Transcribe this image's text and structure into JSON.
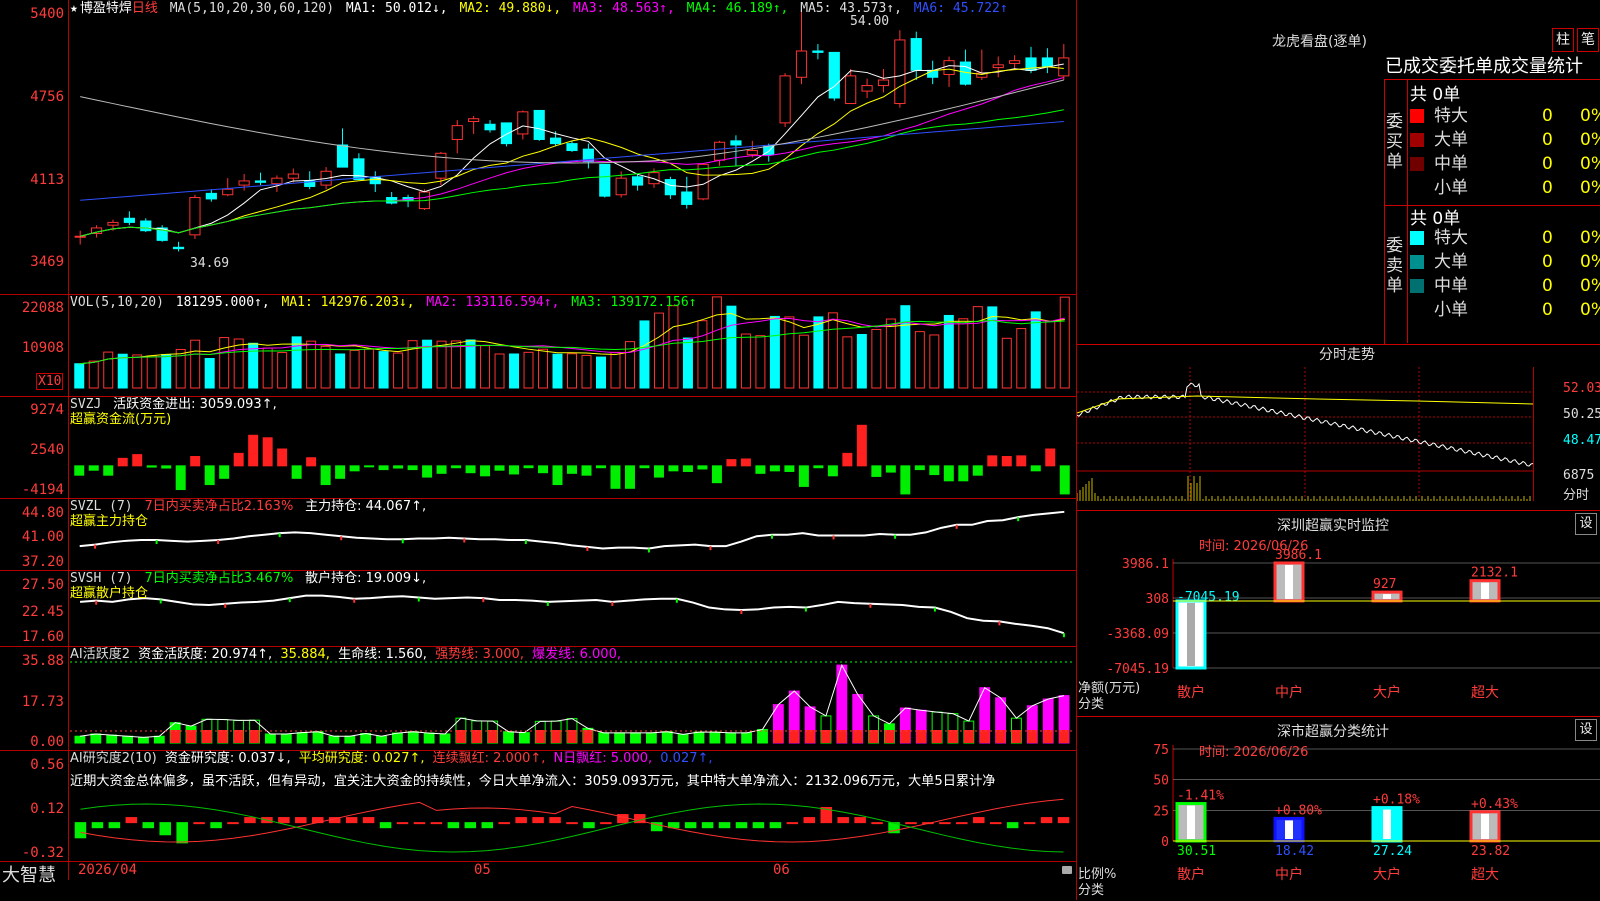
{
  "stock": {
    "name": "博盈特焊",
    "period": "日线",
    "star": "★"
  },
  "main_header": {
    "ma_params": "MA(5,10,20,30,60,120)",
    "ma1": "MA1: 50.012↓,",
    "ma2": "MA2: 49.880↓,",
    "ma3": "MA3: 48.563↑,",
    "ma4": "MA4: 46.189↑,",
    "ma5": "MA5: 43.573↑,",
    "ma6": "MA6: 45.722↑"
  },
  "main_axis": [
    "5400",
    "4756",
    "4113",
    "3469"
  ],
  "main_annotations": {
    "high": "54.00",
    "low": "34.69"
  },
  "vol_header": {
    "params": "VOL(5,10,20)",
    "value": "181295.000↑,",
    "ma1": "MA1: 142976.203↓,",
    "ma2": "MA2: 133116.594↑,",
    "ma3": "MA3: 139172.156↑"
  },
  "vol_axis": [
    "22088",
    "10908"
  ],
  "vol_unit": "X10",
  "svzj_header": {
    "name": "SVZJ",
    "line": "活跃资金进出: 3059.093↑,",
    "sub": "超赢资金流(万元)"
  },
  "svzj_axis": [
    "9274",
    "2540",
    "-4194"
  ],
  "svzl_header": {
    "name": "SVZL (7)",
    "ratio": "7日内买卖净占比2.163%",
    "hold": "主力持仓: 44.067↑,",
    "sub": "超赢主力持仓"
  },
  "svzl_axis": [
    "44.80",
    "41.00",
    "37.20"
  ],
  "svsh_header": {
    "name": "SVSH (7)",
    "ratio": "7日内买卖净占比3.467%",
    "hold": "散户持仓: 19.009↓,",
    "sub": "超赢散户持仓"
  },
  "svsh_axis": [
    "27.50",
    "22.45",
    "17.60"
  ],
  "ai1_header": {
    "name": "AI活跃度2",
    "a": "资金活跃度: 20.974↑,",
    "b": "35.884,",
    "c": "生命线: 1.560,",
    "d": "强势线: 3.000,",
    "e": "爆发线: 6.000,"
  },
  "ai1_axis": [
    "35.88",
    "17.73",
    "0.00"
  ],
  "ai2_header": {
    "name": "AI研究度2(10)",
    "a": "资金研究度: 0.037↓,",
    "b": "平均研究度: 0.027↑,",
    "c": "连续飘红: 2.000↑,",
    "d": "N日飘红: 5.000,",
    "e": "0.027↑,"
  },
  "ai2_text": "近期大资金总体偏多，虽不活跃，但有异动，宜关注大资金的持续性，今日大单净流入：3059.093万元，其中特大单净流入：2132.096万元，大单5日累计净",
  "ai2_axis": [
    "0.56",
    "0.12",
    "-0.32"
  ],
  "date_axis": {
    "start": "2026/04",
    "m05": "05",
    "m06": "06"
  },
  "brand": "大智慧",
  "right": {
    "title": "龙虎看盘(逐单)",
    "btn_zhu": "柱",
    "btn_bi": "笔",
    "tabs": "已成交委托单成交量统计",
    "buy": {
      "label": "委买单",
      "total": "共 0单",
      "rows": [
        {
          "name": "特大",
          "value": "0",
          "pct": "0%",
          "color": "#ff0000"
        },
        {
          "name": "大单",
          "value": "0",
          "pct": "0%",
          "color": "#a00000"
        },
        {
          "name": "中单",
          "value": "0",
          "pct": "0%",
          "color": "#700000"
        },
        {
          "name": "小单",
          "value": "0",
          "pct": "0%",
          "color": "#000000"
        }
      ]
    },
    "sell": {
      "label": "委卖单",
      "total": "共 0单",
      "rows": [
        {
          "name": "特大",
          "value": "0",
          "pct": "0%",
          "color": "#00ffff"
        },
        {
          "name": "大单",
          "value": "0",
          "pct": "0%",
          "color": "#009090"
        },
        {
          "name": "中单",
          "value": "0",
          "pct": "0%",
          "color": "#007070"
        },
        {
          "name": "小单",
          "value": "0",
          "pct": "0%",
          "color": "#000000"
        }
      ]
    },
    "intraday": {
      "title": "分时走势",
      "axis": [
        "52.03",
        "50.25",
        "48.47"
      ],
      "vol_axis": "6875",
      "vol_label": "分时"
    },
    "monitor": {
      "title": "深圳超赢实时监控",
      "time": "时间: 2026/06/26",
      "btn": "设",
      "y_axis": [
        "3986.1",
        "308",
        "-3368.09",
        "-7045.19"
      ],
      "ylabel": "净额(万元)",
      "xlabel": "分类",
      "categories": [
        "散户",
        "中户",
        "大户",
        "超大"
      ],
      "values": [
        -7045.19,
        3986.1,
        927,
        2132.1
      ],
      "value_labels": [
        "-7045.19",
        "3986.1",
        "927",
        "2132.1"
      ]
    },
    "classify": {
      "title": "深市超赢分类统计",
      "time": "时间: 2026/06/26",
      "btn": "设",
      "y_axis": [
        "75",
        "50",
        "25",
        "0"
      ],
      "ylabel": "比例%",
      "xlabel": "分类",
      "categories": [
        "散户",
        "中户",
        "大户",
        "超大"
      ],
      "values": [
        30.51,
        18.42,
        27.24,
        23.82
      ],
      "value_labels": [
        "30.51",
        "18.42",
        "27.24",
        "23.82"
      ],
      "changes": [
        "-1.41%",
        "+0.80%",
        "+0.18%",
        "+0.43%"
      ]
    }
  },
  "chart_data": [
    {
      "type": "candlestick",
      "title": "博盈特焊 日线",
      "ohlc": [
        [
          37.6,
          38.0,
          37.0,
          37.6
        ],
        [
          37.8,
          38.4,
          37.5,
          38.2
        ],
        [
          38.4,
          38.8,
          38.0,
          38.6
        ],
        [
          38.9,
          39.4,
          38.4,
          38.6
        ],
        [
          38.7,
          38.9,
          37.9,
          38.0
        ],
        [
          38.2,
          38.4,
          37.2,
          37.3
        ],
        [
          36.8,
          37.2,
          36.5,
          36.7
        ],
        [
          37.7,
          40.6,
          37.4,
          40.4
        ],
        [
          40.7,
          41.0,
          40.1,
          40.3
        ],
        [
          40.6,
          41.8,
          40.5,
          41.0
        ],
        [
          41.3,
          42.1,
          40.9,
          41.6
        ],
        [
          41.6,
          42.2,
          41.3,
          41.5
        ],
        [
          41.4,
          42.0,
          40.8,
          41.8
        ],
        [
          41.8,
          42.5,
          41.5,
          42.1
        ],
        [
          41.6,
          42.3,
          41.0,
          41.2
        ],
        [
          41.3,
          42.6,
          41.0,
          42.3
        ],
        [
          44.2,
          45.4,
          43.8,
          42.6
        ],
        [
          43.2,
          43.6,
          41.7,
          41.7
        ],
        [
          41.9,
          42.3,
          40.8,
          41.4
        ],
        [
          40.4,
          40.8,
          39.9,
          40.0
        ],
        [
          40.4,
          40.6,
          39.7,
          40.2
        ],
        [
          39.6,
          41.0,
          39.5,
          40.8
        ],
        [
          41.8,
          43.7,
          41.3,
          43.6
        ],
        [
          44.6,
          46.0,
          43.6,
          45.6
        ],
        [
          45.9,
          46.3,
          45.0,
          46.1
        ],
        [
          45.7,
          46.0,
          45.1,
          45.3
        ],
        [
          45.8,
          45.8,
          44.1,
          44.3
        ],
        [
          45.0,
          46.7,
          44.6,
          46.6
        ],
        [
          46.7,
          46.7,
          44.5,
          44.6
        ],
        [
          44.7,
          45.2,
          44.1,
          44.3
        ],
        [
          44.3,
          44.5,
          43.7,
          43.8
        ],
        [
          43.9,
          44.3,
          42.5,
          43.0
        ],
        [
          42.8,
          42.8,
          40.4,
          40.5
        ],
        [
          40.6,
          42.3,
          40.4,
          41.8
        ],
        [
          41.9,
          42.1,
          40.9,
          41.3
        ],
        [
          41.4,
          42.5,
          41.1,
          42.2
        ],
        [
          41.7,
          41.9,
          40.3,
          40.6
        ],
        [
          40.8,
          41.9,
          39.6,
          39.9
        ],
        [
          40.3,
          42.9,
          40.2,
          42.8
        ],
        [
          43.1,
          44.5,
          42.7,
          44.4
        ],
        [
          44.5,
          44.9,
          42.7,
          44.2
        ],
        [
          43.5,
          44.5,
          43.3,
          43.8
        ],
        [
          44.1,
          44.3,
          43.0,
          43.5
        ],
        [
          45.8,
          49.4,
          45.5,
          49.2
        ],
        [
          49.1,
          54.0,
          48.6,
          51.0
        ],
        [
          51.0,
          51.5,
          50.4,
          50.9
        ],
        [
          50.9,
          50.9,
          47.4,
          47.6
        ],
        [
          47.2,
          49.7,
          47.2,
          49.2
        ],
        [
          48.1,
          49.0,
          47.6,
          48.5
        ],
        [
          48.5,
          49.7,
          48.0,
          48.9
        ],
        [
          47.2,
          52.5,
          46.9,
          51.8
        ],
        [
          51.9,
          52.4,
          48.9,
          49.6
        ],
        [
          49.6,
          50.3,
          48.6,
          49.1
        ],
        [
          49.3,
          50.6,
          48.4,
          50.3
        ],
        [
          50.2,
          51.1,
          48.5,
          48.6
        ],
        [
          49.1,
          51.1,
          48.9,
          49.4
        ],
        [
          49.8,
          50.6,
          49.1,
          50.0
        ],
        [
          50.1,
          50.7,
          49.7,
          50.3
        ],
        [
          50.5,
          51.3,
          49.4,
          49.6
        ],
        [
          50.5,
          51.2,
          49.4,
          49.9
        ],
        [
          49.2,
          51.5,
          48.9,
          50.5
        ]
      ],
      "y_range": [
        34.0,
        54.4
      ]
    },
    {
      "type": "bar",
      "name": "VOL",
      "values": [
        10200,
        11300,
        15100,
        14200,
        13900,
        13500,
        14100,
        16200,
        20100,
        12400,
        21200,
        20600,
        18800,
        16800,
        14900,
        21500,
        19700,
        17500,
        14300,
        15800,
        16300,
        15300,
        14700,
        19900,
        20100,
        19700,
        19800,
        20200,
        17800,
        14300,
        14300,
        15000,
        16300,
        14200,
        14400,
        13700,
        13000,
        15000,
        19500,
        28200,
        31500,
        34600,
        21000,
        28300,
        38300,
        34400,
        22700,
        22000,
        30100,
        29900,
        22200,
        29900,
        31600,
        21500,
        22500,
        24600,
        29000,
        34600,
        23700,
        22300,
        30500,
        29100,
        34200,
        34100,
        20900,
        25000,
        32000,
        28000,
        38200
      ],
      "y_range": [
        0,
        37000
      ]
    },
    {
      "type": "bar",
      "name": "SVZJ",
      "values": [
        -1500,
        -700,
        -1500,
        1200,
        1800,
        -200,
        -350,
        -3800,
        1500,
        -3000,
        -2000,
        2000,
        4900,
        4500,
        2700,
        -2000,
        1300,
        -3000,
        -2000,
        -800,
        -150,
        -600,
        -350,
        -600,
        -1800,
        -1200,
        -300,
        -1100,
        -1600,
        -700,
        -1300,
        -300,
        -1100,
        -3000,
        -1200,
        -1500,
        -300,
        -3600,
        -3600,
        -300,
        -1800,
        -800,
        -900,
        -500,
        -2700,
        1000,
        1100,
        -1200,
        -800,
        -900,
        -3300,
        -300,
        -1600,
        2000,
        6500,
        -1700,
        -1000,
        -4500,
        -600,
        -1400,
        -2400,
        -2400,
        -1500,
        1600,
        1500,
        1600,
        -800,
        2700,
        -4500
      ],
      "y_range": [
        -4194,
        9274
      ]
    },
    {
      "type": "line",
      "name": "主力持仓",
      "values": [
        39.8,
        40.0,
        40.3,
        40.5,
        40.6,
        40.6,
        40.5,
        40.4,
        40.5,
        40.6,
        40.8,
        41.1,
        41.3,
        41.5,
        41.6,
        41.5,
        41.3,
        41.1,
        40.9,
        40.8,
        40.7,
        40.7,
        40.8,
        40.8,
        40.9,
        40.8,
        40.7,
        40.7,
        40.6,
        40.6,
        40.4,
        40.2,
        39.9,
        39.7,
        39.5,
        39.6,
        39.6,
        39.5,
        39.8,
        39.9,
        40.0,
        39.8,
        39.8,
        40.4,
        41.1,
        41.3,
        41.3,
        41.5,
        41.2,
        41.2,
        41.2,
        41.2,
        41.4,
        41.3,
        41.3,
        41.6,
        42.2,
        42.6,
        42.6,
        43.1,
        43.2,
        43.6,
        43.9,
        44.1,
        44.3
      ],
      "y_range": [
        37.2,
        44.8
      ]
    },
    {
      "type": "line",
      "name": "散户持仓",
      "values": [
        24.0,
        24.2,
        24.0,
        24.4,
        24.6,
        24.4,
        24.0,
        23.6,
        23.5,
        23.7,
        23.9,
        24.0,
        24.2,
        24.6,
        25.0,
        25.0,
        24.8,
        24.5,
        24.6,
        24.8,
        24.9,
        24.7,
        24.5,
        24.6,
        24.7,
        24.6,
        24.3,
        24.3,
        24.2,
        24.0,
        24.1,
        24.2,
        24.3,
        24.0,
        24.2,
        24.4,
        24.5,
        24.5,
        23.9,
        23.1,
        22.8,
        22.7,
        22.8,
        23.1,
        23.2,
        23.1,
        23.5,
        24.0,
        23.8,
        23.7,
        23.6,
        23.5,
        23.2,
        23.1,
        22.4,
        21.4,
        21.0,
        20.9,
        20.5,
        20.2,
        19.8,
        19.0
      ],
      "y_range": [
        17.6,
        27.5
      ]
    },
    {
      "type": "bar",
      "name": "资金活跃度",
      "values": [
        3,
        4,
        3.5,
        3,
        2.5,
        3,
        9,
        7.5,
        10.5,
        10.4,
        10,
        10.1,
        4,
        4,
        4.6,
        5,
        3,
        3,
        4.2,
        3,
        4.4,
        5,
        4.4,
        4,
        11,
        9.8,
        9.7,
        5,
        4.6,
        9.6,
        9.7,
        10.8,
        6.5,
        4.5,
        4.5,
        4.5,
        4.5,
        5,
        3.8,
        4.8,
        4.8,
        4.5,
        4.5,
        6,
        17,
        23,
        16,
        12,
        34.5,
        21.5,
        12,
        8.5,
        15.5,
        14.5,
        13.7,
        13,
        9.7,
        24.5,
        20,
        11,
        16.5,
        19.5,
        21
      ],
      "y_range": [
        0,
        35.88
      ]
    },
    {
      "type": "bar",
      "name": "资金研究度",
      "values": [
        -0.15,
        -0.05,
        -0.05,
        0.05,
        -0.05,
        -0.12,
        -0.2,
        0.0,
        -0.05,
        0.0,
        0.05,
        0.05,
        0.05,
        0.05,
        0.05,
        0.05,
        0.05,
        0.05,
        -0.05,
        0.0,
        0.0,
        0.0,
        -0.05,
        -0.05,
        -0.05,
        0.0,
        0.05,
        0.05,
        0.05,
        0.0,
        -0.05,
        0.0,
        0.08,
        0.08,
        -0.08,
        -0.05,
        -0.05,
        -0.05,
        -0.05,
        -0.05,
        -0.05,
        -0.05,
        0.0,
        0.05,
        0.15,
        0.05,
        0.05,
        0.0,
        -0.1,
        0.0,
        0.0,
        0.0,
        0.0,
        0.05,
        0.0,
        -0.05,
        0.0,
        0.05,
        0.05
      ],
      "y_range": [
        -0.32,
        0.56
      ]
    }
  ]
}
